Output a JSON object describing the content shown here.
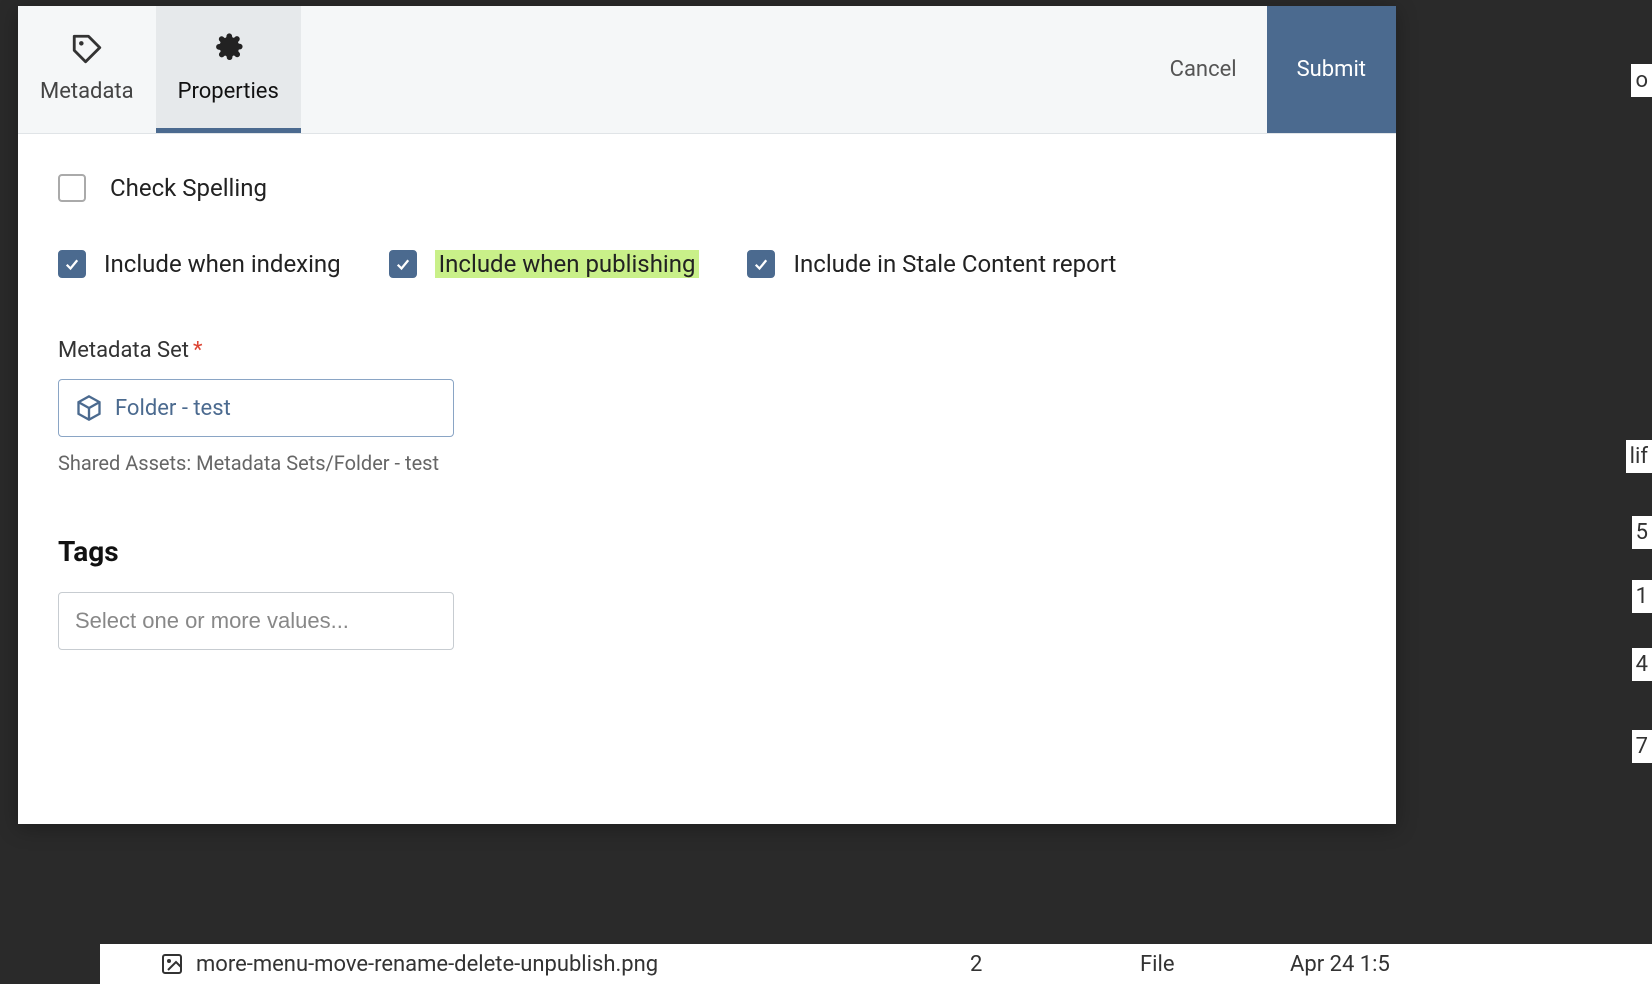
{
  "header": {
    "tabs": [
      {
        "label": "Metadata",
        "icon": "tag"
      },
      {
        "label": "Properties",
        "icon": "gear"
      }
    ],
    "active_tab_index": 1,
    "cancel_label": "Cancel",
    "submit_label": "Submit"
  },
  "checkboxes": {
    "check_spelling": {
      "label": "Check Spelling",
      "checked": false
    },
    "include_indexing": {
      "label": "Include when indexing",
      "checked": true
    },
    "include_publishing": {
      "label": "Include when publishing",
      "checked": true,
      "highlighted": true
    },
    "include_stale": {
      "label": "Include in Stale Content report",
      "checked": true
    }
  },
  "metadata_set": {
    "label": "Metadata Set",
    "required": "*",
    "value": "Folder - test",
    "helper": "Shared Assets: Metadata Sets/Folder - test"
  },
  "tags": {
    "heading": "Tags",
    "placeholder": "Select one or more values..."
  },
  "background": {
    "filename": "more-menu-move-rename-delete-unpublish.png",
    "count": "2",
    "type": "File",
    "date": "Apr 24 1:5"
  },
  "side_fragments": {
    "o": "o",
    "lif": "lif",
    "five": "5",
    "one": "1",
    "four": "4",
    "seven": "7"
  }
}
